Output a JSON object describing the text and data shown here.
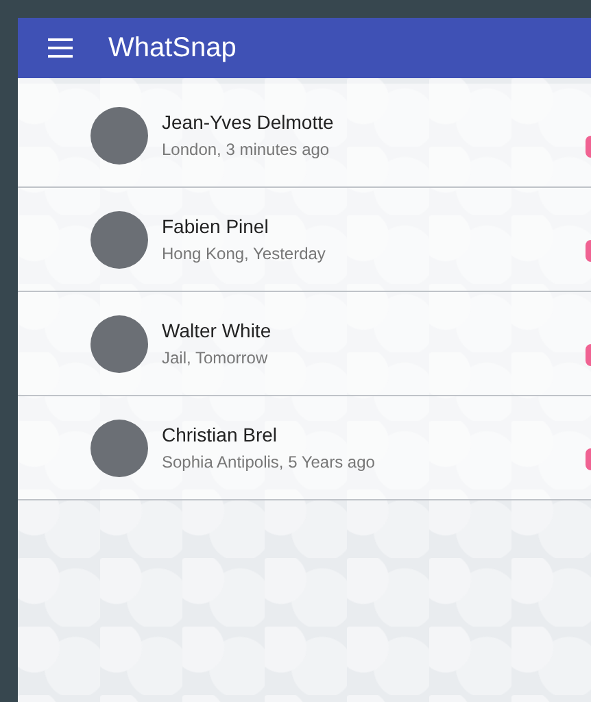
{
  "app_bar": {
    "title": "WhatSnap"
  },
  "contacts": [
    {
      "name": "Jean-Yves Delmotte",
      "detail": "London, 3 minutes ago"
    },
    {
      "name": "Fabien Pinel",
      "detail": "Hong Kong, Yesterday"
    },
    {
      "name": "Walter White",
      "detail": "Jail, Tomorrow"
    },
    {
      "name": "Christian Brel",
      "detail": "Sophia Antipolis, 5 Years ago"
    }
  ]
}
